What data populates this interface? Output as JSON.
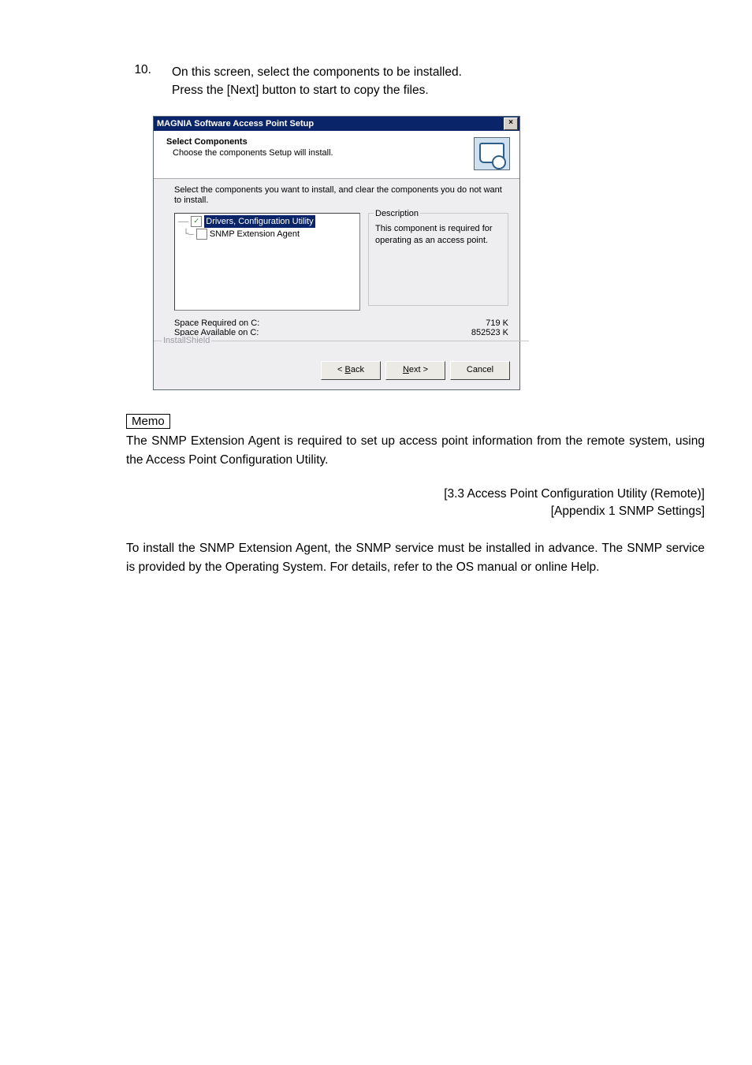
{
  "step": {
    "number": "10.",
    "line1": "On this screen, select the components to be installed.",
    "line2": "Press the [Next] button to start to copy the files."
  },
  "dialog": {
    "title": "MAGNIA Software Access Point Setup",
    "close_label": "×",
    "header_title": "Select Components",
    "header_sub": "Choose the components Setup will install.",
    "select_text": "Select the components you want to install, and clear the components you do not want to install.",
    "tree": {
      "item1": {
        "checked": "✓",
        "label": "Drivers, Configuration Utility"
      },
      "item2": {
        "checked": "",
        "label": "SNMP Extension Agent"
      }
    },
    "description_legend": "Description",
    "description_text": "This component is required for operating as an access point.",
    "space_required_label": "Space Required on   C:",
    "space_required_value": "719 K",
    "space_available_label": "Space Available on   C:",
    "space_available_value": "852523 K",
    "install_shield": "InstallShield",
    "btn_back_pre": "< ",
    "btn_back_u": "B",
    "btn_back_post": "ack",
    "btn_next_u": "N",
    "btn_next_post": "ext >",
    "btn_cancel": "Cancel"
  },
  "memo_label": "Memo",
  "memo_text": "The SNMP Extension Agent is required to set up access point information from the remote system, using the Access Point Configuration Utility.",
  "ref1": "[3.3  Access Point Configuration Utility (Remote)]",
  "ref2": "[Appendix 1   SNMP Settings]",
  "para2": "To install the SNMP Extension Agent, the SNMP service must be installed in advance.  The SNMP service is provided by the Operating System.   For details, refer to the OS manual or online Help."
}
